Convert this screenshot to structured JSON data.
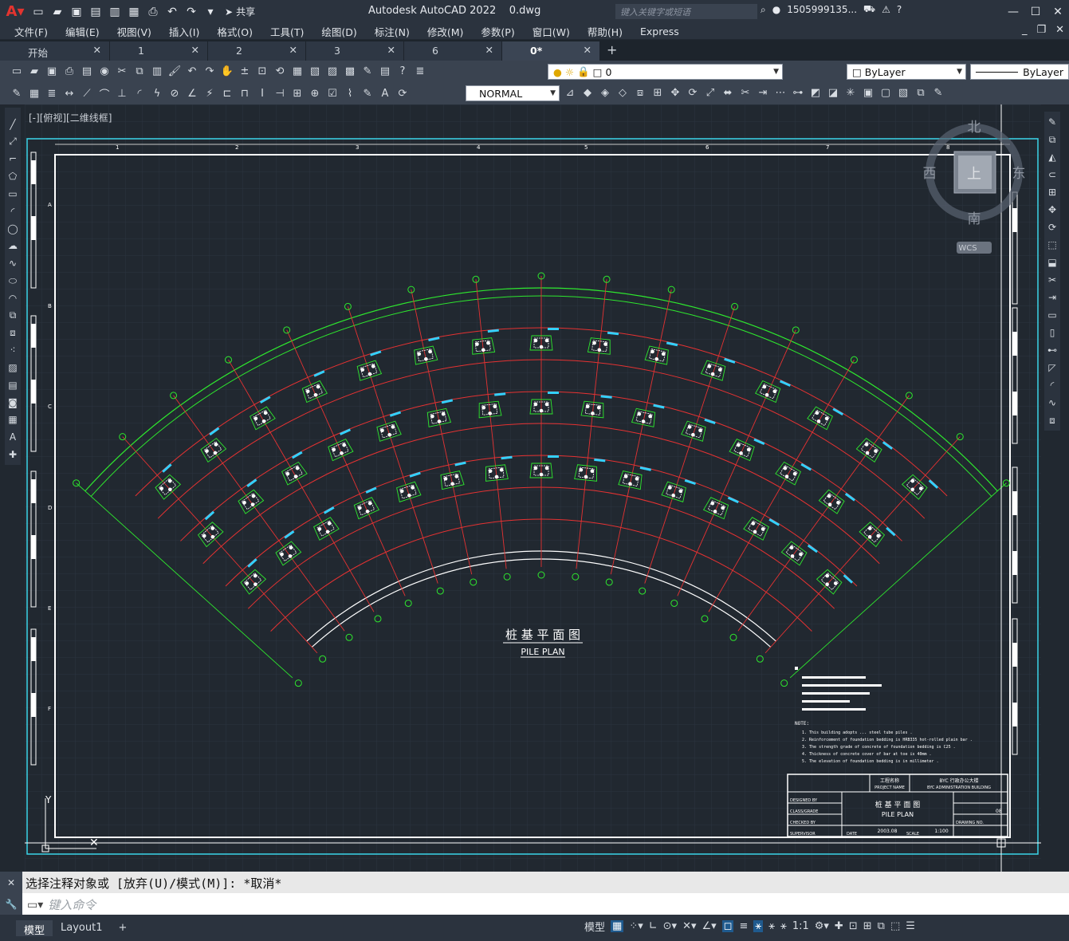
{
  "app": {
    "title": "Autodesk AutoCAD 2022",
    "filename": "0.dwg",
    "search_placeholder": "键入关键字或短语",
    "user": "1505999135...",
    "share_label": "共享"
  },
  "menu": [
    "文件(F)",
    "编辑(E)",
    "视图(V)",
    "插入(I)",
    "格式(O)",
    "工具(T)",
    "绘图(D)",
    "标注(N)",
    "修改(M)",
    "参数(P)",
    "窗口(W)",
    "帮助(H)",
    "Express"
  ],
  "tabs": [
    {
      "label": "开始"
    },
    {
      "label": "1"
    },
    {
      "label": "2"
    },
    {
      "label": "3"
    },
    {
      "label": "6"
    },
    {
      "label": "0*"
    }
  ],
  "toolbar": {
    "layer_value": "0",
    "color_value": "ByLayer",
    "linetype_value": "ByLayer",
    "dimstyle_value": "NORMAL"
  },
  "viewport_label": "[-][俯视][二维线框]",
  "viewcube": {
    "north": "北",
    "south": "南",
    "east": "东",
    "west": "西",
    "top": "上",
    "wcs": "WCS"
  },
  "drawing": {
    "title_cn": "桩 基 平 面 图",
    "title_en": "PILE PLAN",
    "column_numbers": [
      "1",
      "2",
      "3",
      "4",
      "5",
      "6",
      "7",
      "8"
    ],
    "row_letters": [
      "A",
      "B",
      "C",
      "D",
      "E",
      "F"
    ],
    "notes_heading": "NOTE:",
    "notes_en": [
      "1. This building adopts ... steel tube piles .",
      "2. Reinforcement of foundation bedding is HRB335 hot-rolled plain bar .",
      "3. The strength grade of concrete of foundation bedding is C25 .",
      "4. Thickness of concrete cover of bar at toe is 40mm .",
      "5. The elevation of foundation bedding is in millimeter ."
    ],
    "titleblock": {
      "project_label_cn": "工程名称",
      "project_label_en": "PROJECT NAME",
      "project_name": "BYC ADMINISTRATION BUILDING",
      "project_name_cn": "BYC 行政办公大楼",
      "sheet_cn": "桩 基 平 面 图",
      "sheet_en": "PILE PLAN",
      "designed_by": "DESIGNED BY",
      "class_grade": "CLASS/GRADE",
      "checked_by": "CHECKED BY",
      "supervisor": "SUPERVISOR",
      "date": "2003.08",
      "scale": "1:100",
      "date_label": "DATE",
      "scale_label": "SCALE",
      "drawing_no": "DRAWING NO.",
      "sheet_no": "08"
    }
  },
  "command": {
    "history": "选择注释对象或 [放弃(U)/模式(M)]: *取消*",
    "placeholder": "键入命令"
  },
  "status": {
    "layout_tabs": [
      "模型",
      "Layout1"
    ],
    "model_label": "模型",
    "scale": "1:1"
  },
  "colors": {
    "background": "#212830",
    "grid": "#2c3440",
    "frame": "#ffffff",
    "axis_green": "#2ee82e",
    "axis_red": "#e63232",
    "pile_cyan": "#33d1ff",
    "viewport_border": "#3ad4e8"
  }
}
